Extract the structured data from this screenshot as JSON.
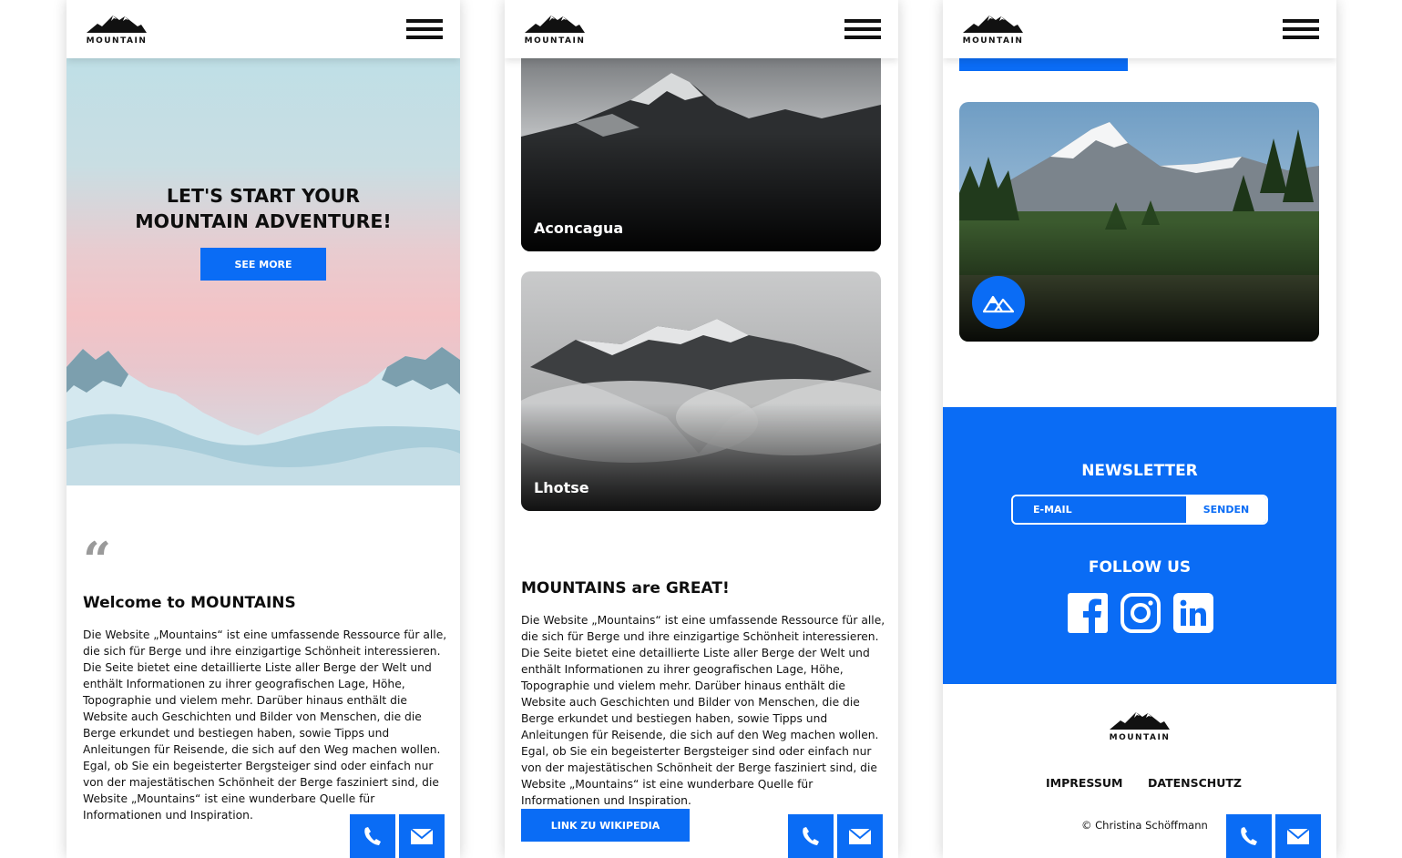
{
  "brand": {
    "logo_text": "MOUNTAIN"
  },
  "colors": {
    "accent": "#0a6cf5",
    "text": "#111111",
    "white": "#ffffff"
  },
  "icons": {
    "menu": "hamburger-menu-icon",
    "phone": "phone-icon",
    "mail": "mail-icon",
    "quote": "quote-icon",
    "badge": "mountain-badge-icon"
  },
  "screen1": {
    "hero_title_line1": "LET'S START YOUR",
    "hero_title_line2": "MOUNTAIN ADVENTURE!",
    "hero_button": "SEE MORE",
    "quote_mark": "“",
    "section_title": "Welcome to MOUNTAINS",
    "section_text": "Die Website „Mountains“ ist eine umfassende Ressource für alle, die sich für Berge und ihre einzigartige Schönheit interessieren. Die Seite bietet eine detaillierte Liste aller Berge der Welt und enthält Informationen zu ihrer geografischen Lage, Höhe, Topographie und vielem mehr. Darüber hinaus enthält die Website auch Geschichten und Bilder von Menschen, die die Berge erkundet und bestiegen haben, sowie Tipps und Anleitungen für Reisende, die sich auf den Weg machen wollen. Egal, ob Sie ein begeisterter Bergsteiger sind oder einfach nur von der majestätischen Schönheit der Berge fasziniert sind, die Website „Mountains“ ist eine wunderbare Quelle für Informationen und Inspiration."
  },
  "screen2": {
    "cards": [
      {
        "label": "Aconcagua"
      },
      {
        "label": "Lhotse"
      }
    ],
    "section_title": "MOUNTAINS are GREAT!",
    "section_text": "Die Website „Mountains“ ist eine umfassende Ressource für alle, die sich für Berge und ihre einzigartige Schönheit interessieren. Die Seite bietet eine detaillierte Liste aller Berge der Welt und enthält Informationen zu ihrer geografischen Lage, Höhe, Topographie und vielem mehr. Darüber hinaus enthält die Website auch Geschichten und Bilder von Menschen, die die Berge erkundet und bestiegen haben, sowie Tipps und Anleitungen für Reisende, die sich auf den Weg machen wollen. Egal, ob Sie ein begeisterter Bergsteiger sind oder einfach nur von der majestätischen Schönheit der Berge fasziniert sind, die Website „Mountains“ ist eine wunderbare Quelle für Informationen und Inspiration.",
    "wiki_button": "LINK ZU WIKIPEDIA"
  },
  "screen3": {
    "newsletter_title": "NEWSLETTER",
    "email_placeholder": "E-MAIL",
    "send_button": "SENDEN",
    "follow_title": "FOLLOW US",
    "socials": [
      "facebook-icon",
      "instagram-icon",
      "linkedin-icon"
    ],
    "footer_links": [
      "IMPRESSUM",
      "DATENSCHUTZ"
    ],
    "copyright": "© Christina Schöffmann"
  }
}
